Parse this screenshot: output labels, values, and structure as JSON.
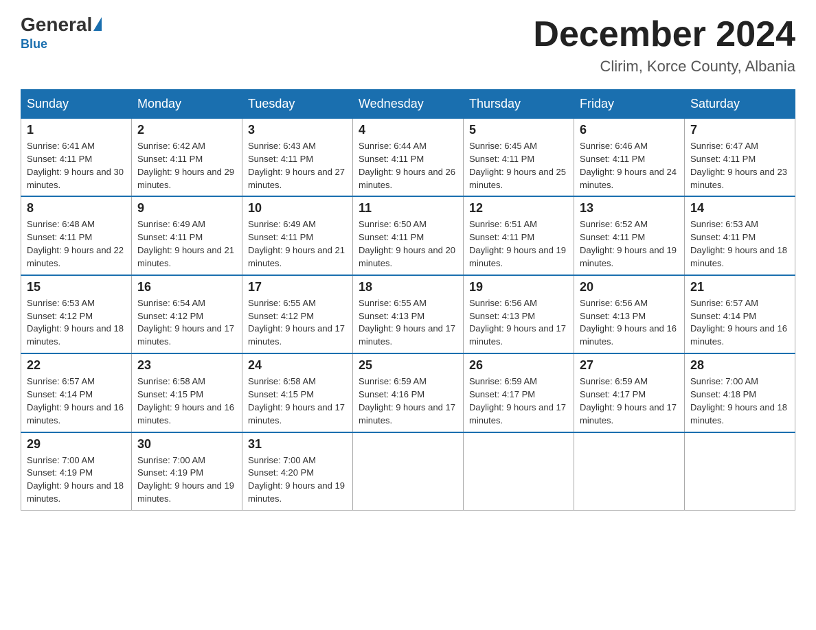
{
  "header": {
    "logo_general": "General",
    "logo_blue": "Blue",
    "month_title": "December 2024",
    "location": "Clirim, Korce County, Albania"
  },
  "days_of_week": [
    "Sunday",
    "Monday",
    "Tuesday",
    "Wednesday",
    "Thursday",
    "Friday",
    "Saturday"
  ],
  "weeks": [
    [
      {
        "day": "1",
        "sunrise": "6:41 AM",
        "sunset": "4:11 PM",
        "daylight": "9 hours and 30 minutes."
      },
      {
        "day": "2",
        "sunrise": "6:42 AM",
        "sunset": "4:11 PM",
        "daylight": "9 hours and 29 minutes."
      },
      {
        "day": "3",
        "sunrise": "6:43 AM",
        "sunset": "4:11 PM",
        "daylight": "9 hours and 27 minutes."
      },
      {
        "day": "4",
        "sunrise": "6:44 AM",
        "sunset": "4:11 PM",
        "daylight": "9 hours and 26 minutes."
      },
      {
        "day": "5",
        "sunrise": "6:45 AM",
        "sunset": "4:11 PM",
        "daylight": "9 hours and 25 minutes."
      },
      {
        "day": "6",
        "sunrise": "6:46 AM",
        "sunset": "4:11 PM",
        "daylight": "9 hours and 24 minutes."
      },
      {
        "day": "7",
        "sunrise": "6:47 AM",
        "sunset": "4:11 PM",
        "daylight": "9 hours and 23 minutes."
      }
    ],
    [
      {
        "day": "8",
        "sunrise": "6:48 AM",
        "sunset": "4:11 PM",
        "daylight": "9 hours and 22 minutes."
      },
      {
        "day": "9",
        "sunrise": "6:49 AM",
        "sunset": "4:11 PM",
        "daylight": "9 hours and 21 minutes."
      },
      {
        "day": "10",
        "sunrise": "6:49 AM",
        "sunset": "4:11 PM",
        "daylight": "9 hours and 21 minutes."
      },
      {
        "day": "11",
        "sunrise": "6:50 AM",
        "sunset": "4:11 PM",
        "daylight": "9 hours and 20 minutes."
      },
      {
        "day": "12",
        "sunrise": "6:51 AM",
        "sunset": "4:11 PM",
        "daylight": "9 hours and 19 minutes."
      },
      {
        "day": "13",
        "sunrise": "6:52 AM",
        "sunset": "4:11 PM",
        "daylight": "9 hours and 19 minutes."
      },
      {
        "day": "14",
        "sunrise": "6:53 AM",
        "sunset": "4:11 PM",
        "daylight": "9 hours and 18 minutes."
      }
    ],
    [
      {
        "day": "15",
        "sunrise": "6:53 AM",
        "sunset": "4:12 PM",
        "daylight": "9 hours and 18 minutes."
      },
      {
        "day": "16",
        "sunrise": "6:54 AM",
        "sunset": "4:12 PM",
        "daylight": "9 hours and 17 minutes."
      },
      {
        "day": "17",
        "sunrise": "6:55 AM",
        "sunset": "4:12 PM",
        "daylight": "9 hours and 17 minutes."
      },
      {
        "day": "18",
        "sunrise": "6:55 AM",
        "sunset": "4:13 PM",
        "daylight": "9 hours and 17 minutes."
      },
      {
        "day": "19",
        "sunrise": "6:56 AM",
        "sunset": "4:13 PM",
        "daylight": "9 hours and 17 minutes."
      },
      {
        "day": "20",
        "sunrise": "6:56 AM",
        "sunset": "4:13 PM",
        "daylight": "9 hours and 16 minutes."
      },
      {
        "day": "21",
        "sunrise": "6:57 AM",
        "sunset": "4:14 PM",
        "daylight": "9 hours and 16 minutes."
      }
    ],
    [
      {
        "day": "22",
        "sunrise": "6:57 AM",
        "sunset": "4:14 PM",
        "daylight": "9 hours and 16 minutes."
      },
      {
        "day": "23",
        "sunrise": "6:58 AM",
        "sunset": "4:15 PM",
        "daylight": "9 hours and 16 minutes."
      },
      {
        "day": "24",
        "sunrise": "6:58 AM",
        "sunset": "4:15 PM",
        "daylight": "9 hours and 17 minutes."
      },
      {
        "day": "25",
        "sunrise": "6:59 AM",
        "sunset": "4:16 PM",
        "daylight": "9 hours and 17 minutes."
      },
      {
        "day": "26",
        "sunrise": "6:59 AM",
        "sunset": "4:17 PM",
        "daylight": "9 hours and 17 minutes."
      },
      {
        "day": "27",
        "sunrise": "6:59 AM",
        "sunset": "4:17 PM",
        "daylight": "9 hours and 17 minutes."
      },
      {
        "day": "28",
        "sunrise": "7:00 AM",
        "sunset": "4:18 PM",
        "daylight": "9 hours and 18 minutes."
      }
    ],
    [
      {
        "day": "29",
        "sunrise": "7:00 AM",
        "sunset": "4:19 PM",
        "daylight": "9 hours and 18 minutes."
      },
      {
        "day": "30",
        "sunrise": "7:00 AM",
        "sunset": "4:19 PM",
        "daylight": "9 hours and 19 minutes."
      },
      {
        "day": "31",
        "sunrise": "7:00 AM",
        "sunset": "4:20 PM",
        "daylight": "9 hours and 19 minutes."
      },
      null,
      null,
      null,
      null
    ]
  ],
  "labels": {
    "sunrise_prefix": "Sunrise: ",
    "sunset_prefix": "Sunset: ",
    "daylight_prefix": "Daylight: "
  }
}
